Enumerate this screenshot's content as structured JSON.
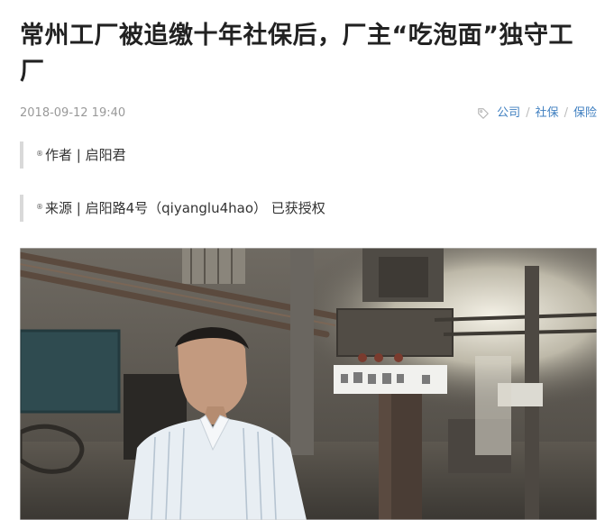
{
  "article": {
    "title": "常州工厂被追缴十年社保后，厂主“吃泡面”独守工厂",
    "date": "2018-09-12 19:40",
    "tags": [
      "公司",
      "社保",
      "保险"
    ],
    "tag_separator": "/",
    "author_mark": "®",
    "author_line": "作者 | 启阳君",
    "source_mark": "®",
    "source_line": "来源 | 启阳路4号（qiyanglu4hao） 已获授权"
  },
  "colors": {
    "tag_blue": "#3f7fc0",
    "meta_gray": "#999999",
    "quote_bar": "#d9d9d9"
  },
  "icons": {
    "tag": "tag-icon"
  }
}
